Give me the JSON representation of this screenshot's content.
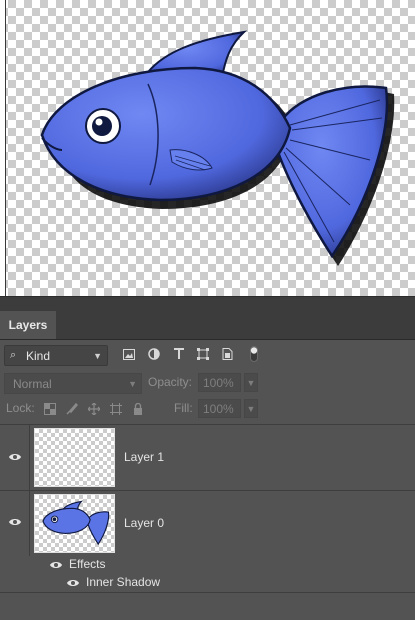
{
  "panel": {
    "tab_label": "Layers",
    "filter": {
      "kind_label": "Kind"
    },
    "blend_mode": "Normal",
    "opacity_label": "Opacity:",
    "opacity_value": "100%",
    "lock_label": "Lock:",
    "fill_label": "Fill:",
    "fill_value": "100%"
  },
  "layers": [
    {
      "name": "Layer 1",
      "visible": true
    },
    {
      "name": "Layer 0",
      "visible": true,
      "effects_label": "Effects",
      "effect_name": "Inner Shadow"
    }
  ],
  "colors": {
    "fish_body": "#5a74e6",
    "fish_outline": "#101a4a",
    "panel_bg": "#535353"
  }
}
